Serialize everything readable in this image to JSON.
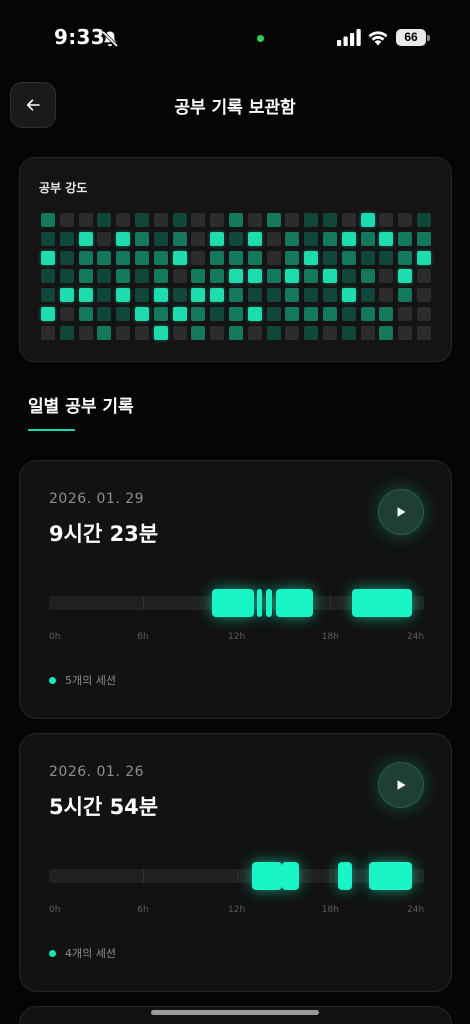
{
  "status_bar": {
    "time": "9:33",
    "battery": "66"
  },
  "header": {
    "title": "공부 기록 보관함"
  },
  "intensity": {
    "title": "공부 강도",
    "rows": [
      [
        2,
        0,
        0,
        1,
        0,
        1,
        0,
        1,
        0,
        0,
        2,
        0,
        2,
        0,
        1,
        1,
        0,
        3,
        0,
        0,
        1
      ],
      [
        1,
        1,
        3,
        0,
        3,
        2,
        1,
        2,
        0,
        3,
        1,
        3,
        0,
        2,
        1,
        2,
        3,
        2,
        3,
        2,
        2
      ],
      [
        3,
        1,
        2,
        2,
        2,
        2,
        2,
        3,
        0,
        2,
        2,
        2,
        0,
        2,
        3,
        1,
        2,
        1,
        1,
        2,
        3
      ],
      [
        1,
        1,
        2,
        1,
        2,
        1,
        2,
        0,
        2,
        2,
        3,
        3,
        2,
        3,
        2,
        3,
        1,
        2,
        0,
        3,
        0
      ],
      [
        1,
        3,
        3,
        1,
        3,
        1,
        3,
        1,
        3,
        3,
        2,
        1,
        1,
        2,
        1,
        1,
        3,
        1,
        0,
        2,
        0
      ],
      [
        3,
        0,
        2,
        1,
        1,
        3,
        2,
        3,
        2,
        1,
        2,
        3,
        1,
        2,
        2,
        2,
        1,
        2,
        2,
        0,
        0
      ],
      [
        0,
        1,
        0,
        2,
        0,
        0,
        3,
        0,
        2,
        0,
        2,
        0,
        1,
        0,
        1,
        0,
        1,
        0,
        2,
        0,
        0
      ]
    ]
  },
  "section": {
    "title": "일별 공부 기록"
  },
  "axis_labels": [
    "0h",
    "6h",
    "12h",
    "18h",
    "24h"
  ],
  "days": [
    {
      "date": "2026. 01. 29",
      "duration": "9시간 23분",
      "sessions_text": "5개의 세션",
      "sessions": [
        {
          "start_h": 10.4,
          "end_h": 13.1
        },
        {
          "start_h": 13.3,
          "end_h": 13.6
        },
        {
          "start_h": 13.9,
          "end_h": 14.3
        },
        {
          "start_h": 14.5,
          "end_h": 16.9
        },
        {
          "start_h": 19.4,
          "end_h": 23.2
        }
      ]
    },
    {
      "date": "2026. 01. 26",
      "duration": "5시간 54분",
      "sessions_text": "4개의 세션",
      "sessions": [
        {
          "start_h": 13.0,
          "end_h": 14.9
        },
        {
          "start_h": 14.9,
          "end_h": 16.0
        },
        {
          "start_h": 18.5,
          "end_h": 19.4
        },
        {
          "start_h": 20.5,
          "end_h": 23.2
        }
      ]
    }
  ],
  "colors": {
    "accent": "#19f5c6",
    "background": "#050505",
    "card": "#121212"
  }
}
